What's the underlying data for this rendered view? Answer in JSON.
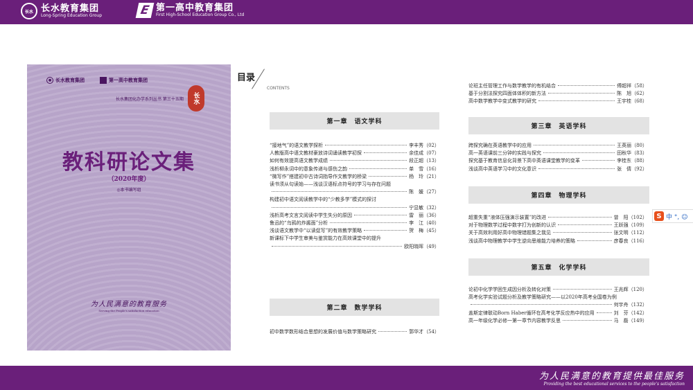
{
  "header": {
    "brand1_mark": "长水",
    "brand1_cn": "长水教育集团",
    "brand1_en": "Long-Spring Education Group",
    "brand2_mark": "E",
    "brand2_cn": "第一高中教育集团",
    "brand2_en": "First High-School Education Group Co., Ltd"
  },
  "footer": {
    "slogan_cn": "为人民满意的教育提供最佳服务",
    "slogan_en": "Providing the best educational services to the people's satisfaction"
  },
  "cover": {
    "logo1": "长水教育集团",
    "logo2": "第一高中教育集团",
    "series": "长水集团化办学系列丛书 第三十五期",
    "seal": "长水",
    "title": "教科研论文集",
    "year": "（2020年度）",
    "editor": "◎本书编写组",
    "motto": "为人民满意的教育服务",
    "motto_en": "Serving the People's satisfaction education"
  },
  "toc": {
    "heading": "目录",
    "subheading": "CONTENTS",
    "ch1": "第一章　语文学科",
    "ch1_items": [
      {
        "title": "“接地气”的语文教学探析",
        "author": "李丰秀（02）"
      },
      {
        "title": "人教版高中语文教材豪放诗词诵读教学初探",
        "author": "余佳成（07）"
      },
      {
        "title": "如何有效提高语文教学成绩",
        "author": "段正超（13）"
      },
      {
        "title": "浅析柳永词中的意象传递与感伤之韵",
        "author": "单　雪（16）"
      },
      {
        "title": "“微写作”搭建初中古诗词指导作文教学的桥梁",
        "author": "杨　玲（21）"
      }
    ],
    "ch1_item6_line1": "读书须从句读始——浅谈汉语标点符号的学习与存在问题",
    "ch1_item6_line2": "陈　媛（27）",
    "ch1_item7_line1": "构建初中语文阅读教学中的“少教多学”模式的探讨",
    "ch1_item7_line2": "宁显敏（32）",
    "ch1_items_b": [
      {
        "title": "浅析高考文言文阅读中学生失分的原因",
        "author": "雷　丽（36）"
      },
      {
        "title": "鲁迅的“乌鸦的炸酱面”分析",
        "author": "李　江（40）"
      },
      {
        "title": "浅谈语文教学中“以读促写”的有效教学策略",
        "author": "贺　梅（45）"
      }
    ],
    "ch1_item11_line1": "新课标下中学生审美与鉴赏能力在高效课堂中的提升",
    "ch1_item11_line2": "欧阳晓晖（49）",
    "ch2": "第二章　数学学科",
    "ch2_items": [
      {
        "title": "初中数学数形结合思想的发展价值与数学策略研究",
        "author": "郭华才（54）"
      }
    ],
    "right_top_items": [
      {
        "title": "论班主任管理工作与数学教学的有机结合",
        "author": "傅超祥（58）"
      },
      {
        "title": "基于分割法探究四面体体积的新方法",
        "author": "陈　旭（62）"
      },
      {
        "title": "高中数学教学中变式教学的研究",
        "author": "王宇桂（68）"
      }
    ],
    "ch3": "第三章　英语学科",
    "ch3_items": [
      {
        "title": "跨探究确在英语教学中的应用",
        "author": "王英丽（80）"
      },
      {
        "title": "高一英语课前三分钟的实践与探究",
        "author": "田秋华（83）"
      },
      {
        "title": "探究基于教育信息化背景下高中英语课堂教学的变革",
        "author": "李桂东（88）"
      },
      {
        "title": "浅谈高中英语学习中的文化意识",
        "author": "张　倩（92）"
      }
    ],
    "ch4": "第四章　物理学科",
    "ch4_items": [
      {
        "title": "超重失重“液体压强演示装置”的改进",
        "author": "曾　阳（102）"
      },
      {
        "title": "对于物理数学过程中数字打为创新的认识",
        "author": "王跃强（109）"
      },
      {
        "title": "关于高效利用好高中物理错题集之我见",
        "author": "张文明（112）"
      },
      {
        "title": "浅谈高中物理教学中学生逆向思维能力培养的策略",
        "author": "彦春良（116）"
      }
    ],
    "ch5": "第五章　化学学科",
    "ch5_items": [
      {
        "title": "论初中化学学困生成因分析及转化对策",
        "author": "王兆辉（120）"
      }
    ],
    "ch5_item2_line1": "高考化学实验试题分析及教学策略研究——以2020年高考全国卷为例",
    "ch5_item2_line2": "何宇舟（132）",
    "ch5_items_b": [
      {
        "title": "盖斯定律联动Born Haber循环在高考化学反应热中的应用",
        "author": "刘　芬（142）"
      },
      {
        "title": "高一年级化学必修一第一章节内容教学反思",
        "author": "马　磊（149）"
      }
    ]
  },
  "ime": {
    "logo": "S",
    "chars": "中 °, ☺"
  }
}
